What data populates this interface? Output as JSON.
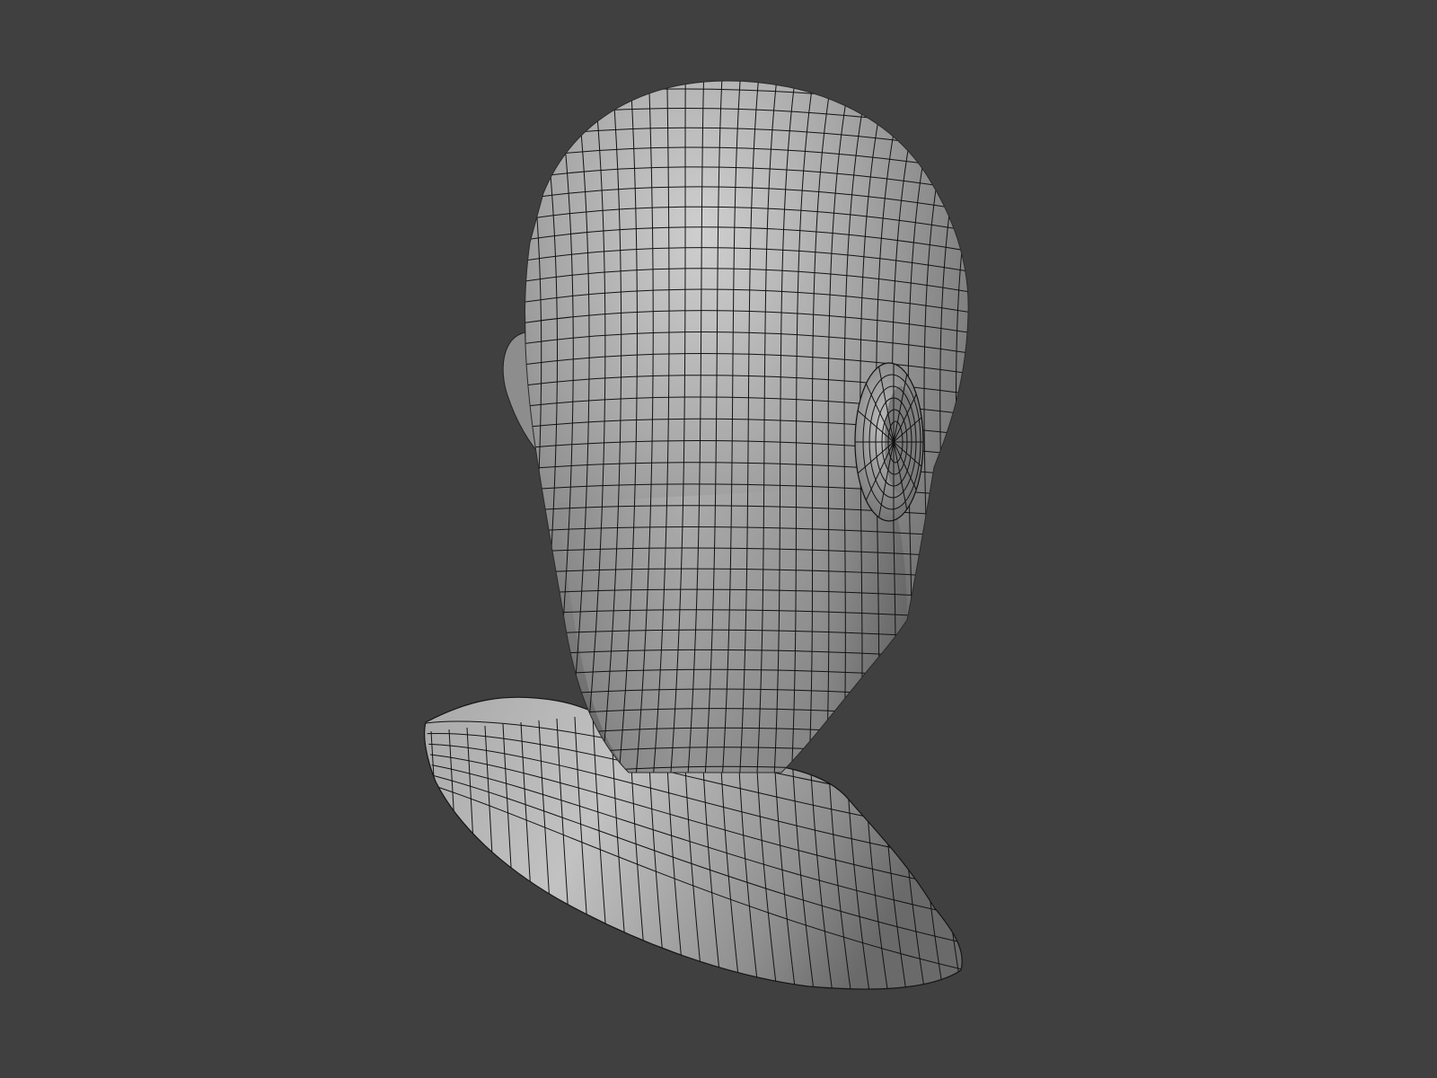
{
  "viewport": {
    "background_color": "#404040",
    "model_base_color": "#9a9a9a",
    "model_highlight_color": "#cfcfcf",
    "model_shadow_color": "#5e5e5e",
    "wireframe_color": "#111111"
  },
  "model": {
    "subject": "head-and-neck-mesh",
    "view": "back-three-quarter",
    "wireframe_overlay": true
  }
}
